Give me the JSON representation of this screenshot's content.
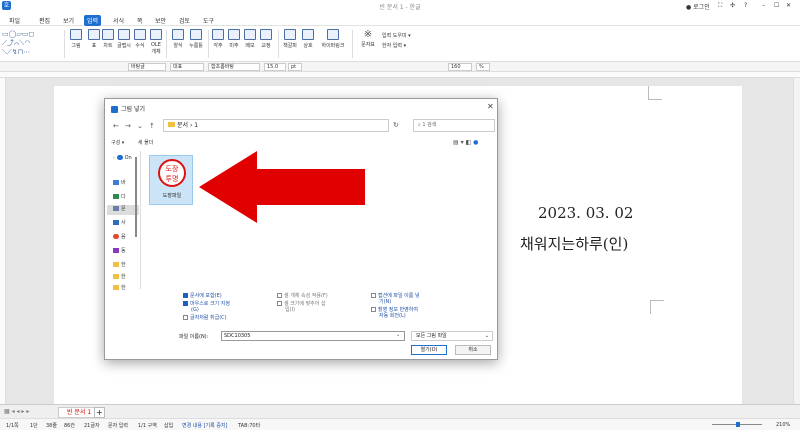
{
  "titlebar": {
    "logo": "호",
    "title": "빈 문서 1 - 한글",
    "login": "로그인",
    "right_icons": [
      "⛶",
      "✣",
      "?",
      "–",
      "☐",
      "✕"
    ]
  },
  "menu": {
    "file": "파일",
    "items": [
      "편집",
      "보기",
      "입력",
      "서식",
      "쪽",
      "보안",
      "검토",
      "도구"
    ],
    "active_index": 2
  },
  "ribbon": {
    "labels": [
      "그림",
      "표",
      "차트",
      "글맵시",
      "수식",
      "OLE",
      "개체",
      "양식",
      "누름틀",
      "각주",
      "미주",
      "메모",
      "교정",
      "책갈피",
      "상호",
      "하이퍼링크",
      "문자표",
      "입력 도우미",
      "한자 입력"
    ]
  },
  "format_bar": {
    "style": "바탕글",
    "lang": "대표",
    "font": "함초롬바탕",
    "size": "15.0",
    "unit": "pt",
    "zoom": "160",
    "zoom_unit": "%"
  },
  "document": {
    "date_line": "2023. 03. 02",
    "name_line": "채워지는하루(인)"
  },
  "tabs": {
    "doc_tab": "빈 문서 1",
    "add": "+"
  },
  "status": {
    "items": [
      "1/1쪽",
      "1단",
      "38줄",
      "86칸",
      "21글자",
      "문자 입력",
      "1/1 구역",
      "삽입",
      "변경 내용 [기록 중지]",
      "TAB:70타"
    ],
    "zoom": "210%"
  },
  "dialog": {
    "title": "그림 넣기",
    "close": "✕",
    "nav": [
      "←",
      "→",
      "⌄",
      "↑"
    ],
    "address": "문서 › 1",
    "search_placeholder": "1 검색",
    "toolbar": {
      "organize": "구성 ▾",
      "new_folder": "새 폴더"
    },
    "sidebar": [
      "On",
      "바",
      "다",
      "문",
      "사",
      "음",
      "동",
      "한",
      "한",
      "한"
    ],
    "file": {
      "name": "도장파일",
      "stamp_line1": "도장",
      "stamp_line2": "투명"
    },
    "options": {
      "embed": "문서에 포함(E)",
      "original_size": "마우스로 크기 지정",
      "original_size_sub": "(G)",
      "char_like": "글자처럼 취급(C)",
      "cell_bg": "셀 개체 속성 적용(F)",
      "fit_cell": "셀 크기에 맞추어 삽",
      "fit_cell_sub": "입(I)",
      "file_name_link": "캡션에 파일 이름 넣",
      "file_name_link_sub": "기(N)",
      "auto_wrap": "촬영 정보 반영하여",
      "auto_wrap_sub": "자동 회전(L)"
    },
    "filename_label": "파일 이름(N):",
    "filename_value": "SDC10305",
    "filetype": "모든 그림 파일",
    "open_button": "열기(O)",
    "cancel_button": "취소"
  },
  "colors": {
    "accent": "#1f6fd1",
    "arrow": "#e00000",
    "stamp": "#dd1111"
  }
}
